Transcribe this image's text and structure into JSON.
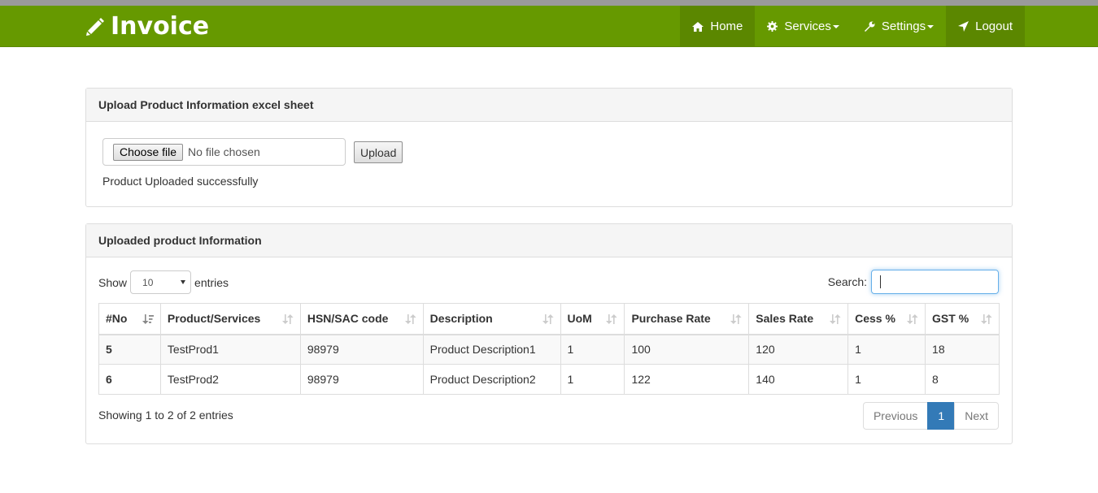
{
  "navbar": {
    "brand": "Invoice",
    "items": [
      {
        "label": "Home",
        "icon": "home-icon",
        "dropdown": false
      },
      {
        "label": "Services",
        "icon": "gear-icon",
        "dropdown": true
      },
      {
        "label": "Settings",
        "icon": "wrench-icon",
        "dropdown": true
      },
      {
        "label": "Logout",
        "icon": "location-arrow-icon",
        "dropdown": false
      }
    ]
  },
  "upload_panel": {
    "title": "Upload Product Information excel sheet",
    "choose_file_label": "Choose file",
    "file_status": "No file chosen",
    "upload_label": "Upload",
    "message": "Product Uploaded successfully"
  },
  "products_panel": {
    "title": "Uploaded product Information",
    "show_label": "Show",
    "entries_label": "entries",
    "page_length": "10",
    "search_label": "Search:",
    "search_value": "",
    "columns": [
      "#No",
      "Product/Services",
      "HSN/SAC code",
      "Description",
      "UoM",
      "Purchase Rate",
      "Sales Rate",
      "Cess %",
      "GST %"
    ],
    "rows": [
      [
        "5",
        "TestProd1",
        "98979",
        "Product Description1",
        "1",
        "100",
        "120",
        "1",
        "18"
      ],
      [
        "6",
        "TestProd2",
        "98979",
        "Product Description2",
        "1",
        "122",
        "140",
        "1",
        "8"
      ]
    ],
    "info": "Showing 1 to 2 of 2 entries",
    "pagination": {
      "previous": "Previous",
      "current": "1",
      "next": "Next"
    }
  },
  "colors": {
    "navbar": "#669900",
    "navbar_active": "#5b8700",
    "pagination_active": "#337ab7"
  }
}
